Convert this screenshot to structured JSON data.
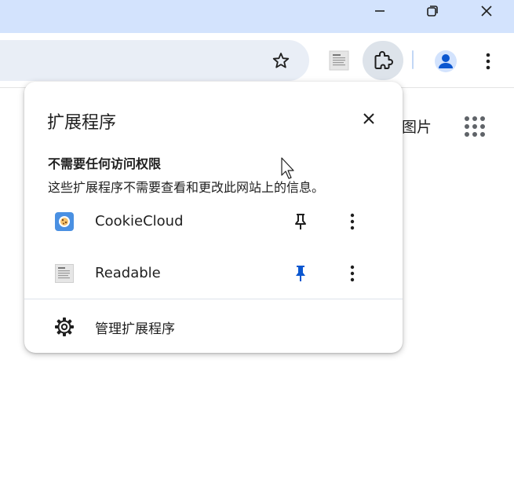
{
  "window": {
    "minimize_icon": "minimize-icon",
    "maximize_icon": "restore-icon",
    "close_icon": "close-icon"
  },
  "toolbar": {
    "bookmark_icon": "star-icon",
    "extensions_icon": "puzzle-icon",
    "profile_icon": "avatar-icon",
    "menu_icon": "kebab-icon"
  },
  "background": {
    "images_link": "图片",
    "apps_icon": "apps-grid-icon"
  },
  "popup": {
    "title": "扩展程序",
    "section_title": "不需要任何访问权限",
    "section_subtitle": "这些扩展程序不需要查看和更改此网站上的信息。",
    "extensions": [
      {
        "name": "CookieCloud",
        "pinned": false
      },
      {
        "name": "Readable",
        "pinned": true
      }
    ],
    "manage_label": "管理扩展程序"
  },
  "colors": {
    "titlebar": "#d3e3fd",
    "omnibox": "#e9eef6",
    "pin_active": "#0b57d0",
    "avatar": "#0b57d0"
  }
}
